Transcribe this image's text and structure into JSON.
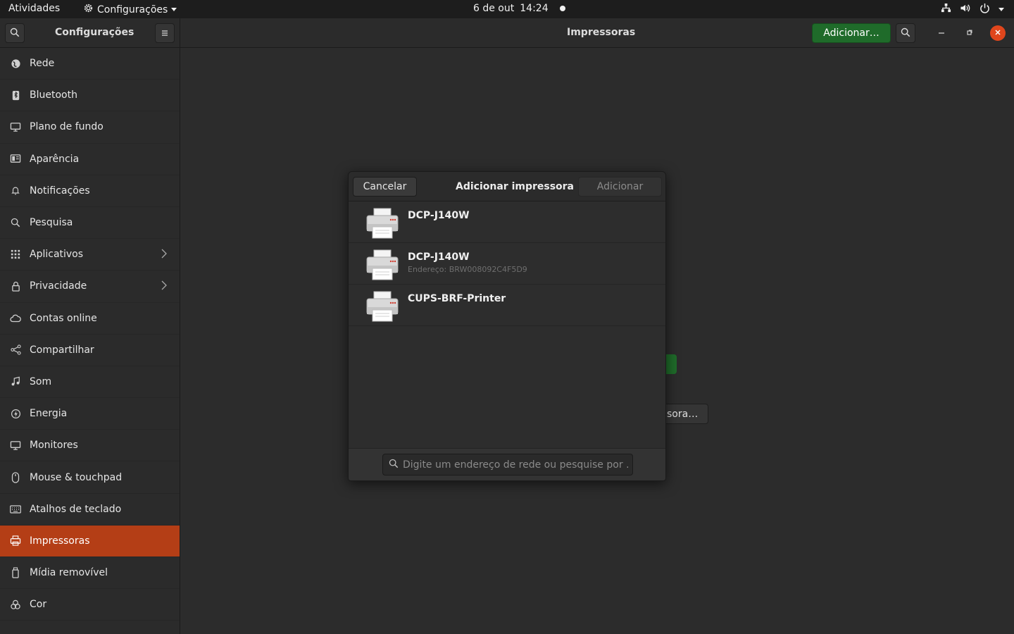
{
  "topbar": {
    "activities": "Atividades",
    "app_menu": "Configurações",
    "date": "6 de out",
    "time": "14:24"
  },
  "header": {
    "sidebar_title": "Configurações",
    "page_title": "Impressoras",
    "add_button": "Adicionar…"
  },
  "sidebar": {
    "items": [
      {
        "label": "Rede",
        "icon": "globe-icon"
      },
      {
        "label": "Bluetooth",
        "icon": "bluetooth-icon"
      },
      {
        "label": "Plano de fundo",
        "icon": "monitor-wallpaper-icon"
      },
      {
        "label": "Aparência",
        "icon": "appearance-icon"
      },
      {
        "label": "Notificações",
        "icon": "bell-icon"
      },
      {
        "label": "Pesquisa",
        "icon": "search-icon"
      },
      {
        "label": "Aplicativos",
        "icon": "apps-grid-icon"
      },
      {
        "label": "Privacidade",
        "icon": "lock-icon"
      },
      {
        "label": "Contas online",
        "icon": "cloud-icon"
      },
      {
        "label": "Compartilhar",
        "icon": "share-icon"
      },
      {
        "label": "Som",
        "icon": "music-note-icon"
      },
      {
        "label": "Energia",
        "icon": "power-icon"
      },
      {
        "label": "Monitores",
        "icon": "display-icon"
      },
      {
        "label": "Mouse & touchpad",
        "icon": "mouse-icon"
      },
      {
        "label": "Atalhos de teclado",
        "icon": "keyboard-icon"
      },
      {
        "label": "Impressoras",
        "icon": "printer-icon"
      },
      {
        "label": "Mídia removível",
        "icon": "usb-drive-icon"
      },
      {
        "label": "Cor",
        "icon": "color-icon"
      }
    ],
    "active_index": 15
  },
  "background": {
    "partial_button_text": "sora…"
  },
  "dialog": {
    "title": "Adicionar impressora",
    "cancel": "Cancelar",
    "add": "Adicionar",
    "printers": [
      {
        "name": "DCP-J140W",
        "address": ""
      },
      {
        "name": "DCP-J140W",
        "address": "Endereço: BRW008092C4F5D9"
      },
      {
        "name": "CUPS-BRF-Printer",
        "address": ""
      }
    ],
    "search_placeholder": "Digite um endereço de rede ou pesquise por …"
  },
  "colors": {
    "accent": "#b43e16",
    "suggested_action": "#1f6b2a",
    "close_button": "#e0461c"
  }
}
